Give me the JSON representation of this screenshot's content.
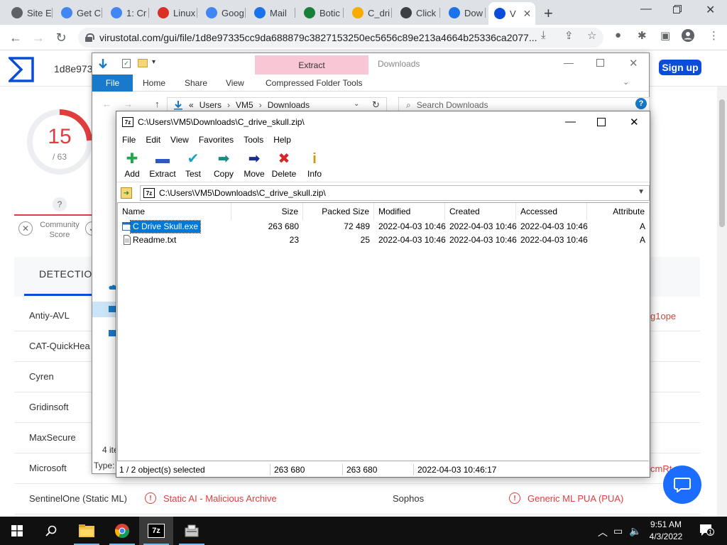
{
  "browser": {
    "tabs": [
      {
        "label": "Site E",
        "color": "#5f6368"
      },
      {
        "label": "Get C",
        "color": "#4285f4"
      },
      {
        "label": "1: Cr",
        "color": "#4285f4"
      },
      {
        "label": "Linux",
        "color": "#d93025"
      },
      {
        "label": "Goog",
        "color": "#4285f4"
      },
      {
        "label": "Mail",
        "color": "#1a73e8"
      },
      {
        "label": "Botic",
        "color": "#188038"
      },
      {
        "label": "C_dri",
        "color": "#f9ab00"
      },
      {
        "label": "Click",
        "color": "#3c4043"
      },
      {
        "label": "Dow",
        "color": "#1a73e8"
      },
      {
        "label": "V",
        "color": "#0b4dda"
      }
    ],
    "url": "virustotal.com/gui/file/1d8e97335cc9da688879c3827153250ec5656c89e213a4664b25336ca2077..."
  },
  "virustotal": {
    "hash_prefix": "1d8e973",
    "signup": "Sign up",
    "score": "15",
    "score_total": "/ 63",
    "question": "?",
    "community_label": "Community Score",
    "detection_tab": "DETECTION",
    "engines": [
      "Antiy-AVL",
      "CAT-QuickHea",
      "Cyren",
      "Gridinsoft",
      "MaxSecure",
      "Microsoft",
      "SentinelOne (Static ML)"
    ],
    "right_partial_1": "g1ope",
    "right_partial_2": "cmRt",
    "sentinel_result": "Static AI - Malicious Archive",
    "sophos_label": "Sophos",
    "sophos_result": "Generic ML PUA (PUA)",
    "accent_red": "#e03e3e",
    "accent_blue": "#0b4dda"
  },
  "explorer": {
    "context_tab": "Extract",
    "title": "Downloads",
    "ribbon_tabs": [
      "File",
      "Home",
      "Share",
      "View"
    ],
    "context_subtab": "Compressed Folder Tools",
    "help": "?",
    "address": {
      "chevron": "«",
      "parts": [
        "Users",
        "VM5",
        "Downloads"
      ]
    },
    "search_placeholder": "Search Downloads",
    "status_items": "4 ite",
    "status_type": "Type:"
  },
  "sevenzip": {
    "icon_text": "7z",
    "title": "C:\\Users\\VM5\\Downloads\\C_drive_skull.zip\\",
    "menu": [
      "File",
      "Edit",
      "View",
      "Favorites",
      "Tools",
      "Help"
    ],
    "tools": [
      {
        "label": "Add",
        "icon": "add-icon",
        "glyph": "✚",
        "color": "#22a84a"
      },
      {
        "label": "Extract",
        "icon": "extract-icon",
        "glyph": "▬",
        "color": "#2e58c9"
      },
      {
        "label": "Test",
        "icon": "test-icon",
        "glyph": "✔",
        "color": "#1ba4c2"
      },
      {
        "label": "Copy",
        "icon": "copy-icon",
        "glyph": "➡",
        "color": "#1e8a86"
      },
      {
        "label": "Move",
        "icon": "move-icon",
        "glyph": "➡",
        "color": "#1a2f8a"
      },
      {
        "label": "Delete",
        "icon": "delete-icon",
        "glyph": "✖",
        "color": "#d7262a"
      },
      {
        "label": "Info",
        "icon": "info-icon",
        "glyph": "i",
        "color": "#c99a10"
      }
    ],
    "path": "C:\\Users\\VM5\\Downloads\\C_drive_skull.zip\\",
    "columns": [
      "Name",
      "Size",
      "Packed Size",
      "Modified",
      "Created",
      "Accessed",
      "Attribute"
    ],
    "rows": [
      {
        "name": "C Drive Skull.exe",
        "size": "263 680",
        "packed": "72 489",
        "modified": "2022-04-03 10:46",
        "created": "2022-04-03 10:46",
        "accessed": "2022-04-03 10:46",
        "attr": "A",
        "selected": true
      },
      {
        "name": "Readme.txt",
        "size": "23",
        "packed": "25",
        "modified": "2022-04-03 10:46",
        "created": "2022-04-03 10:46",
        "accessed": "2022-04-03 10:46",
        "attr": "A",
        "selected": false
      }
    ],
    "status": {
      "selection": "1 / 2 object(s) selected",
      "size": "263 680",
      "packed": "263 680",
      "modified": "2022-04-03 10:46:17"
    }
  },
  "taskbar": {
    "items": [
      "start-icon",
      "search-icon",
      "file-explorer-icon",
      "chrome-icon",
      "7zip-icon",
      "installer-icon"
    ],
    "time": "9:51 AM",
    "date": "4/3/2022",
    "notification_count": "1"
  }
}
